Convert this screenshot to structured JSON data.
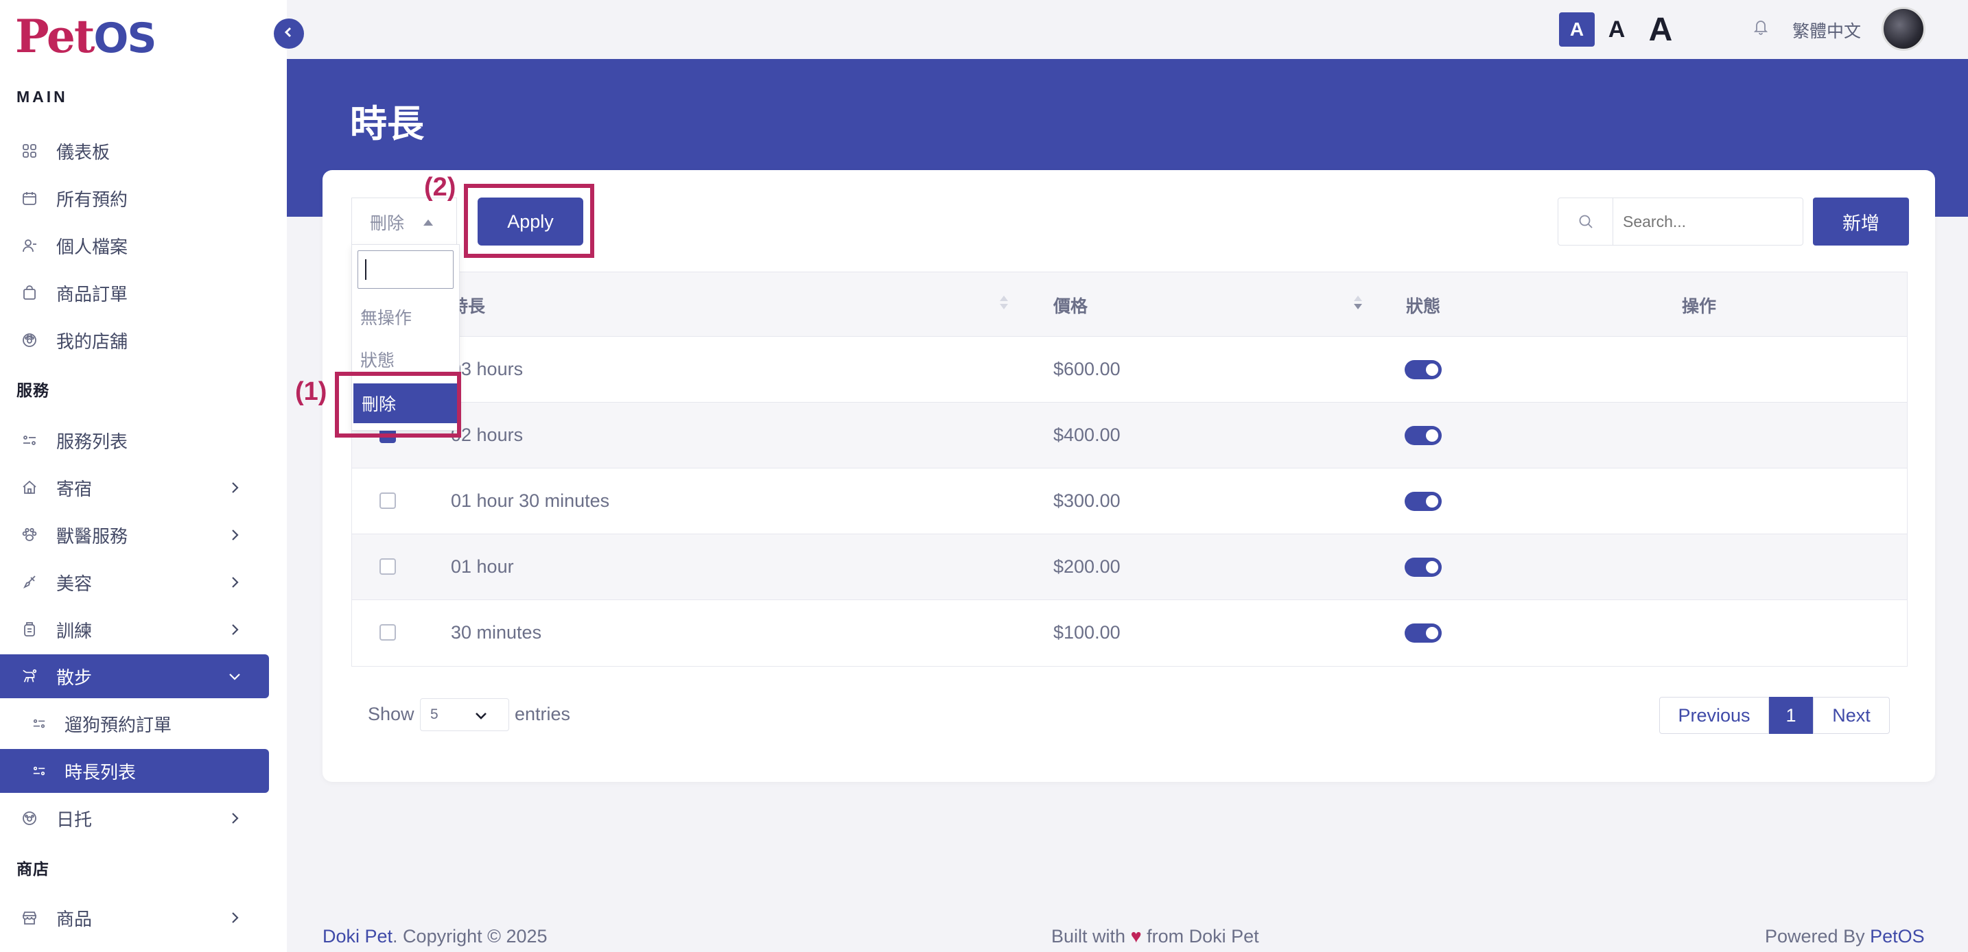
{
  "logo": {
    "pet": "Pet",
    "os": "OS"
  },
  "sidebar": {
    "sections": {
      "main": "MAIN",
      "services": "服務",
      "shop": "商店"
    },
    "items": [
      {
        "label": "儀表板",
        "icon": "dashboard-icon"
      },
      {
        "label": "所有預約",
        "icon": "calendar-icon"
      },
      {
        "label": "個人檔案",
        "icon": "user-icon"
      },
      {
        "label": "商品訂單",
        "icon": "bag-icon"
      },
      {
        "label": "我的店舖",
        "icon": "store-paw-icon"
      },
      {
        "label": "服務列表",
        "icon": "list-icon"
      },
      {
        "label": "寄宿",
        "icon": "home-icon"
      },
      {
        "label": "獸醫服務",
        "icon": "paw-icon"
      },
      {
        "label": "美容",
        "icon": "brush-icon"
      },
      {
        "label": "訓練",
        "icon": "training-icon"
      },
      {
        "label": "散步",
        "icon": "walk-icon"
      },
      {
        "label": "遛狗預約訂單",
        "icon": "list-icon"
      },
      {
        "label": "時長列表",
        "icon": "list-icon"
      },
      {
        "label": "日托",
        "icon": "daycare-icon"
      },
      {
        "label": "商品",
        "icon": "shop-icon"
      }
    ]
  },
  "topbar": {
    "font_sizes": [
      "A",
      "A",
      "A"
    ],
    "language": "繁體中文"
  },
  "page": {
    "title": "時長"
  },
  "toolbar": {
    "bulk_selected": "刪除",
    "bulk_options": [
      "無操作",
      "狀態",
      "刪除"
    ],
    "apply_label": "Apply",
    "search_placeholder": "Search...",
    "add_label": "新增"
  },
  "annotations": {
    "one": "(1)",
    "two": "(2)"
  },
  "table": {
    "headers": [
      "時長",
      "價格",
      "狀態",
      "操作"
    ],
    "rows": [
      {
        "duration": "03 hours",
        "price": "$600.00",
        "checked": false,
        "status": true
      },
      {
        "duration": "02 hours",
        "price": "$400.00",
        "checked": true,
        "status": true
      },
      {
        "duration": "01 hour 30 minutes",
        "price": "$300.00",
        "checked": false,
        "status": true
      },
      {
        "duration": "01 hour",
        "price": "$200.00",
        "checked": false,
        "status": true
      },
      {
        "duration": "30 minutes",
        "price": "$100.00",
        "checked": false,
        "status": true
      }
    ]
  },
  "pagination": {
    "show": "Show",
    "entries_value": "5",
    "entries": "entries",
    "previous": "Previous",
    "current": "1",
    "next": "Next"
  },
  "footer": {
    "brand": "Doki Pet",
    "copyright": ". Copyright © 2025",
    "built_prefix": "Built with",
    "heart": "♥",
    "built_suffix": "from Doki Pet",
    "powered_prefix": "Powered By",
    "powered_brand": "PetOS"
  },
  "colors": {
    "primary": "#3f4aa8",
    "accent": "#c0245a",
    "annotation": "#b8265d"
  }
}
